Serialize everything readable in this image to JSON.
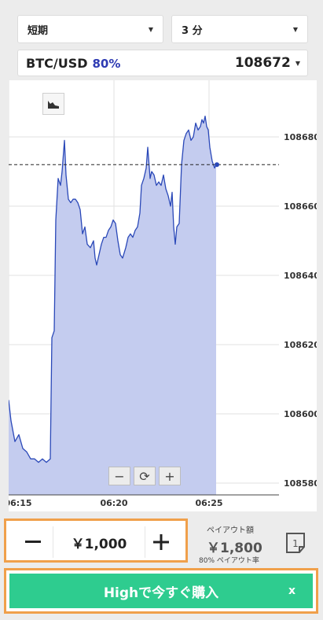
{
  "dropdowns": {
    "mode": "短期",
    "duration": "3 分"
  },
  "pair": {
    "name": "BTC/USD",
    "payout_pct": "80%",
    "price": "108672"
  },
  "chart_data": {
    "type": "area",
    "x_tick_labels": [
      "06:15",
      "06:20",
      "06:25"
    ],
    "y_tick_labels": [
      "108680",
      "108660",
      "108640",
      "108620",
      "108600",
      "108580"
    ],
    "ylim": [
      108578,
      108690
    ],
    "current_price": 108672,
    "x": [
      0,
      3,
      8,
      13,
      18,
      23,
      28,
      33,
      38,
      43,
      48,
      53,
      55,
      58,
      60,
      63,
      66,
      68,
      71,
      73,
      76,
      79,
      82,
      85,
      88,
      91,
      94,
      97,
      100,
      104,
      108,
      110,
      112,
      115,
      118,
      121,
      124,
      127,
      130,
      133,
      136,
      139,
      142,
      145,
      149,
      152,
      155,
      158,
      161,
      164,
      167,
      169,
      172,
      175,
      177,
      180,
      182,
      185,
      188,
      191,
      194,
      197,
      200,
      203,
      206,
      208,
      210,
      212,
      214,
      217,
      220,
      223,
      226,
      229,
      232,
      235,
      238,
      241,
      244,
      246,
      248,
      250,
      252,
      254,
      256,
      259,
      262,
      264
    ],
    "values": [
      108604,
      108598,
      108592,
      108594,
      108590,
      108589,
      108587,
      108587,
      108586,
      108587,
      108586,
      108587,
      108622,
      108624,
      108656,
      108668,
      108666,
      108670,
      108679,
      108669,
      108662,
      108661,
      108662,
      108662,
      108661,
      108659,
      108652,
      108654,
      108649,
      108648,
      108650,
      108645,
      108643,
      108646,
      108649,
      108651,
      108651,
      108653,
      108654,
      108656,
      108655,
      108650,
      108646,
      108645,
      108648,
      108651,
      108652,
      108651,
      108653,
      108654,
      108658,
      108666,
      108668,
      108671,
      108677,
      108668,
      108670,
      108669,
      108666,
      108667,
      108666,
      108669,
      108665,
      108663,
      108660,
      108664,
      108654,
      108649,
      108654,
      108655,
      108672,
      108679,
      108681,
      108682,
      108679,
      108680,
      108684,
      108682,
      108683,
      108685,
      108684,
      108686,
      108683,
      108682,
      108677,
      108673,
      108671,
      108672
    ],
    "grid": true
  },
  "controls": {
    "zoom_out": "−",
    "reset": "⟳",
    "zoom_in": "+"
  },
  "amount": {
    "minus": "−",
    "value": "￥1,000",
    "plus": "+"
  },
  "payout": {
    "label": "ペイアウト額",
    "value": "￥1,800",
    "rate": "80% ペイアウト率"
  },
  "time_icon_label": "1",
  "buy": {
    "label": "Highで今すぐ購入",
    "close": "x"
  },
  "colors": {
    "accent_orange": "#f0a04b",
    "buy_green": "#2ecc8f",
    "line_blue": "#2a48b8",
    "area_fill": "#c4ccef",
    "payout_blue": "#2e3bb3"
  }
}
